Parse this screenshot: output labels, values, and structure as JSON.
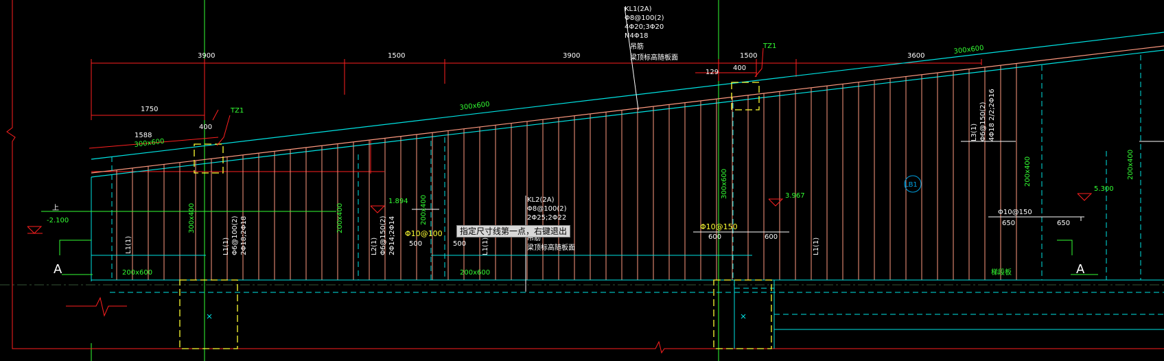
{
  "prompt_tooltip": "指定尺寸线第一点，右键退出",
  "dimensions": {
    "top_row": [
      "3900",
      "1500",
      "3900",
      "1500",
      "3600"
    ],
    "second_row": [
      "1750",
      "129",
      "400",
      "1588",
      "400"
    ],
    "lower": [
      "500",
      "500",
      "600",
      "600",
      "650",
      "650"
    ]
  },
  "beam_sizes": [
    "300x600",
    "300x600",
    "300x600",
    "200x600",
    "200x600",
    "300x400",
    "200x400",
    "200x400",
    "300x600",
    "200x400",
    "200x400"
  ],
  "column_labels": [
    "TZ1",
    "TZ1"
  ],
  "kl1": {
    "l1": "KL1(2A)",
    "l2": "Φ8@100(2)",
    "l3": "4Φ20;3Φ20",
    "l4": "N4Φ18",
    "l5": "吊筋",
    "l6": "梁顶标高随板面"
  },
  "kl2": {
    "l1": "KL2(2A)",
    "l2": "Φ8@100(2)",
    "l3": "2Φ25;2Φ22",
    "l4": "吊筋",
    "l5": "梁顶标高随板面"
  },
  "l1_label": "L1(1)",
  "l2": {
    "l1": "L2(1)",
    "l2": "Φ6@150(2)",
    "l3": "2Φ14;2Φ14"
  },
  "l3": {
    "l1": "L3(1)",
    "l2": "Φ6@150(2)",
    "l3": "4Φ18 2/2;2Φ16"
  },
  "l1b": {
    "l1": "L1(1)",
    "l2": "Φ6@100(2)",
    "l3": "2Φ18;2Φ18"
  },
  "rebar_notes": [
    "Φ10@100",
    "Φ10@150",
    "Φ10@150"
  ],
  "elevations": [
    "-2.100",
    "1.894",
    "3.967",
    "5.300"
  ],
  "slab_label": "LB1",
  "section_marks": [
    "A",
    "A"
  ],
  "misc_label": "梯段板",
  "small_mark": "上",
  "colors": {
    "cyan": "#00e5e5",
    "red": "#ff2020",
    "salmon": "#ff9a80",
    "yellow": "#ffff33",
    "green": "#33ff33",
    "white": "#ffffff"
  }
}
